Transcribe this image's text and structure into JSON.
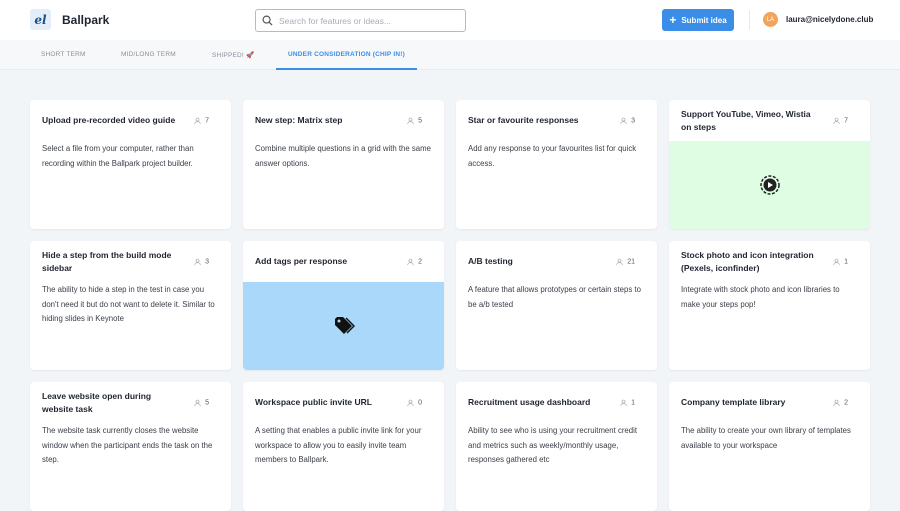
{
  "header": {
    "logo": "el",
    "brand": "Ballpark",
    "search_placeholder": "Search for features or ideas...",
    "submit_label": "Submit idea",
    "avatar_initials": "LA",
    "email": "laura@nicelydone.club"
  },
  "tabs": [
    {
      "label": "SHORT TERM"
    },
    {
      "label": "MID/LONG TERM"
    },
    {
      "label": "SHIPPED! 🚀"
    },
    {
      "label": "UNDER CONSIDERATION (CHIP IN!)"
    }
  ],
  "colors": {
    "accent": "#3b8ee8",
    "video_bg": "#dffde3",
    "tag_bg": "#a9d8fb"
  },
  "cards": [
    {
      "title": "Upload pre-recorded video guide",
      "votes": "7",
      "desc": "Select a file from your computer, rather than recording within the Ballpark project builder."
    },
    {
      "title": "New step: Matrix step",
      "votes": "5",
      "desc": "Combine multiple questions in a grid with the same answer options."
    },
    {
      "title": "Star or favourite responses",
      "votes": "3",
      "desc": "Add any response to your favourites list for quick access."
    },
    {
      "title": "Support YouTube, Vimeo, Wistia on steps",
      "votes": "7",
      "media": "video-play-icon"
    },
    {
      "title": "Hide a step from the build mode sidebar",
      "votes": "3",
      "desc": "The ability to hide a step in the test in case you don't need it but do not want to delete it. Similar to hiding slides in Keynote"
    },
    {
      "title": "Add tags per response",
      "votes": "2",
      "media": "tag-icon"
    },
    {
      "title": "A/B testing",
      "votes": "21",
      "desc": "A feature that allows prototypes or certain steps to be a/b tested"
    },
    {
      "title": "Stock photo and icon integration (Pexels, iconfinder)",
      "votes": "1",
      "desc": "Integrate with stock photo and icon libraries to make your steps pop!"
    },
    {
      "title": "Leave website open during website task",
      "votes": "5",
      "desc": "The website task currently closes the website window when the participant ends the task on the step."
    },
    {
      "title": "Workspace public invite URL",
      "votes": "0",
      "desc": "A setting that enables a public invite link for your workspace to allow you to easily invite team members to Ballpark."
    },
    {
      "title": "Recruitment usage dashboard",
      "votes": "1",
      "desc": "Ability to see who is using your recruitment credit and metrics such as weekly/monthly usage, responses gathered etc"
    },
    {
      "title": "Company template library",
      "votes": "2",
      "desc": "The ability to create your own library of templates available to your workspace"
    }
  ]
}
